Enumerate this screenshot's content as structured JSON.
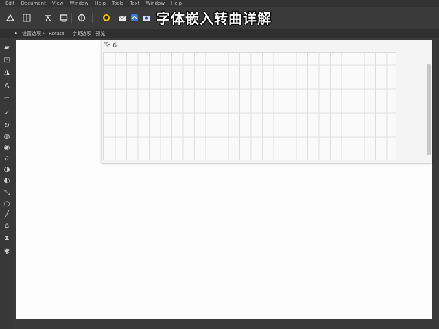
{
  "overlay_title": "字体嵌入转曲详解",
  "menu": [
    "Edit",
    "Document",
    "View",
    "Window",
    "Help",
    "Tools",
    "Text",
    "Window",
    "Help"
  ],
  "options_bar": [
    "设置选项 ›",
    "Rotate — 字距选项",
    "预览"
  ],
  "toolbar_icons": [
    "app-icon",
    "grid-icon",
    "text-icon",
    "frame-icon",
    "power-icon",
    "circle-icon",
    "mail-icon",
    "cloud-icon",
    "camera-icon"
  ],
  "left_tools": [
    "select-tool",
    "direct-tool",
    "pen-tool",
    "type-tool",
    "line-tool",
    "check-tool",
    "rotate-tool",
    "shape-tool",
    "ellipse-tool",
    "curve-tool",
    "arc-tool",
    "crop-tool",
    "scale-tool",
    "brush-tool",
    "eraser-tool",
    "hourglass-tool",
    "star-tool"
  ],
  "panel": {
    "title": "To 6"
  },
  "colors": {
    "chrome": "#3a3a3a",
    "canvas": "#fdfdfd",
    "grid": "#dedede"
  }
}
